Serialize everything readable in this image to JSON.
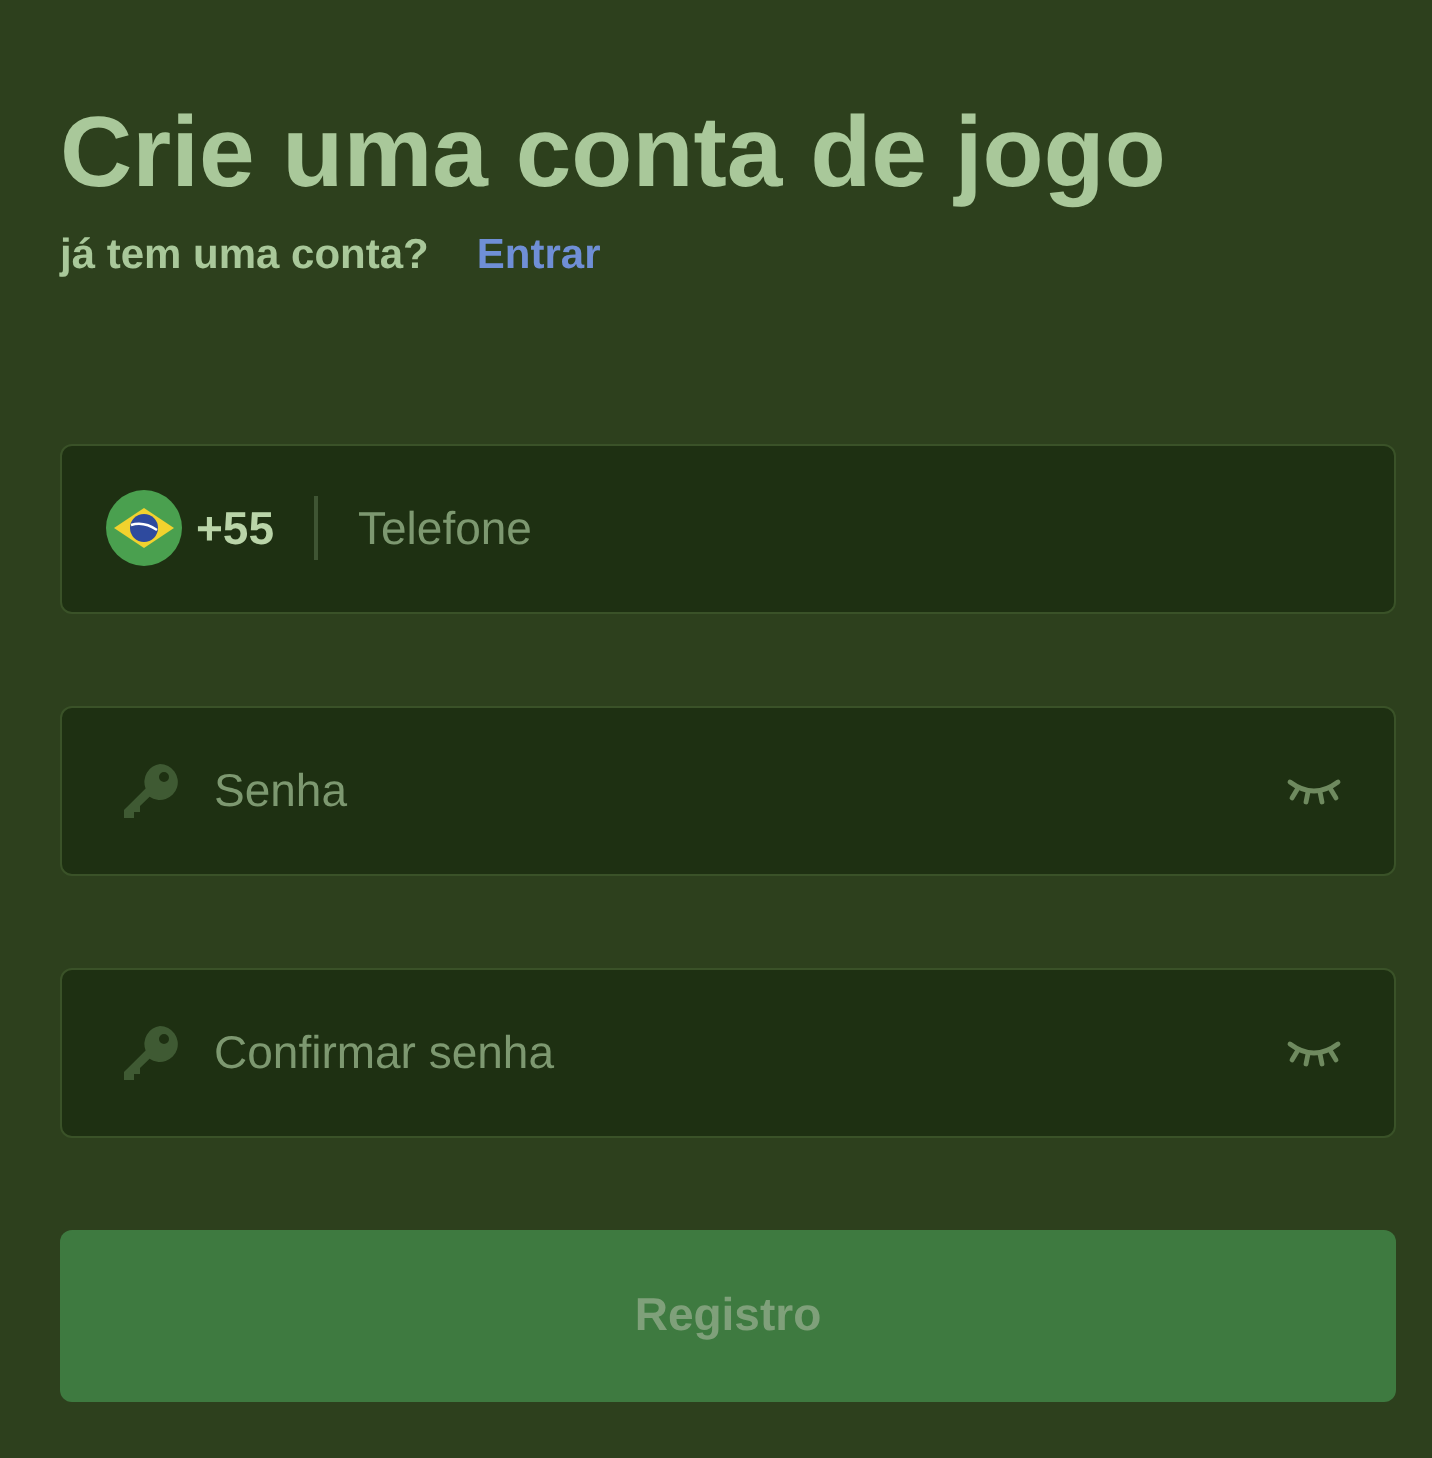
{
  "title": "Crie uma conta de jogo",
  "login_prompt": {
    "text": "já tem uma conta?",
    "link": "Entrar"
  },
  "fields": [
    {
      "kind": "phone",
      "country_code": "+55",
      "placeholder": "Telefone"
    },
    {
      "kind": "password",
      "placeholder": "Senha"
    },
    {
      "kind": "password",
      "placeholder": "Confirmar senha"
    }
  ],
  "submit_button": {
    "label": "Registro"
  }
}
